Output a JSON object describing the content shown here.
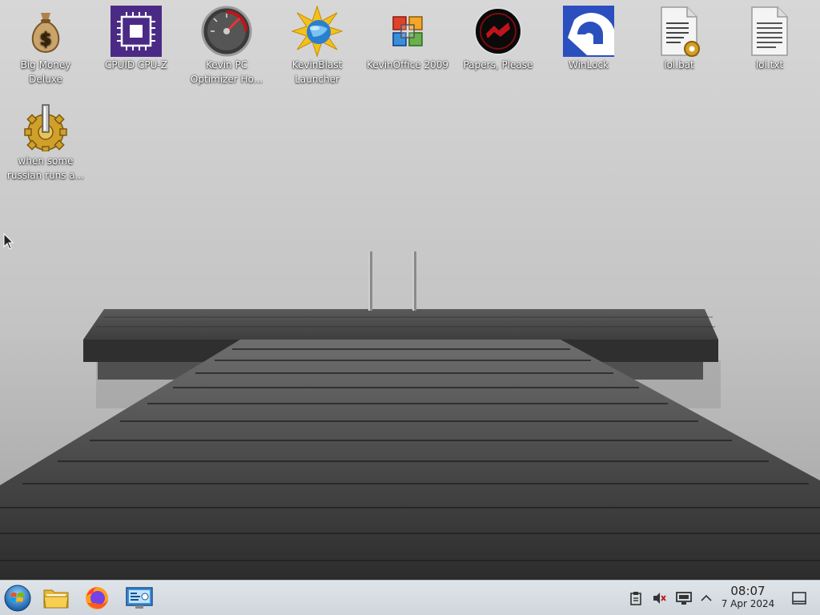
{
  "desktop": {
    "icons": [
      {
        "label": "Big Money Deluxe",
        "icon": "money-bag-icon"
      },
      {
        "label": "CPUID CPU-Z",
        "icon": "cpu-chip-icon"
      },
      {
        "label": "Kevin PC Optimizer Ho...",
        "icon": "speedometer-icon"
      },
      {
        "label": "KevinBlast Launcher",
        "icon": "starburst-globe-icon"
      },
      {
        "label": "KevinOffice 2009",
        "icon": "office-logo-icon"
      },
      {
        "label": "Papers, Please",
        "icon": "papers-please-seal-icon"
      },
      {
        "label": "WinLock",
        "icon": "lock-arc-icon"
      },
      {
        "label": "lol.bat",
        "icon": "batch-file-icon"
      },
      {
        "label": "lol.txt",
        "icon": "text-file-icon"
      },
      {
        "label": "when some russian runs a...",
        "icon": "gear-lever-icon"
      }
    ]
  },
  "taskbar": {
    "start_icon": "start-orb-icon",
    "pinned": [
      {
        "icon": "file-manager-folder-icon"
      },
      {
        "icon": "firefox-icon"
      },
      {
        "icon": "control-panel-icon"
      }
    ],
    "tray": [
      {
        "icon": "clipboard-icon"
      },
      {
        "icon": "volume-muted-icon"
      },
      {
        "icon": "display-icon"
      },
      {
        "icon": "chevron-up-icon"
      }
    ],
    "clock": {
      "time": "08:07",
      "date": "7 Apr 2024"
    },
    "show_desktop_icon": "show-desktop-icon"
  },
  "colors": {
    "taskbar_bg": "#d8dee3",
    "cpuz_purple": "#4b2a86",
    "winlock_blue": "#2b4fbf",
    "accent_red": "#c0141c"
  }
}
